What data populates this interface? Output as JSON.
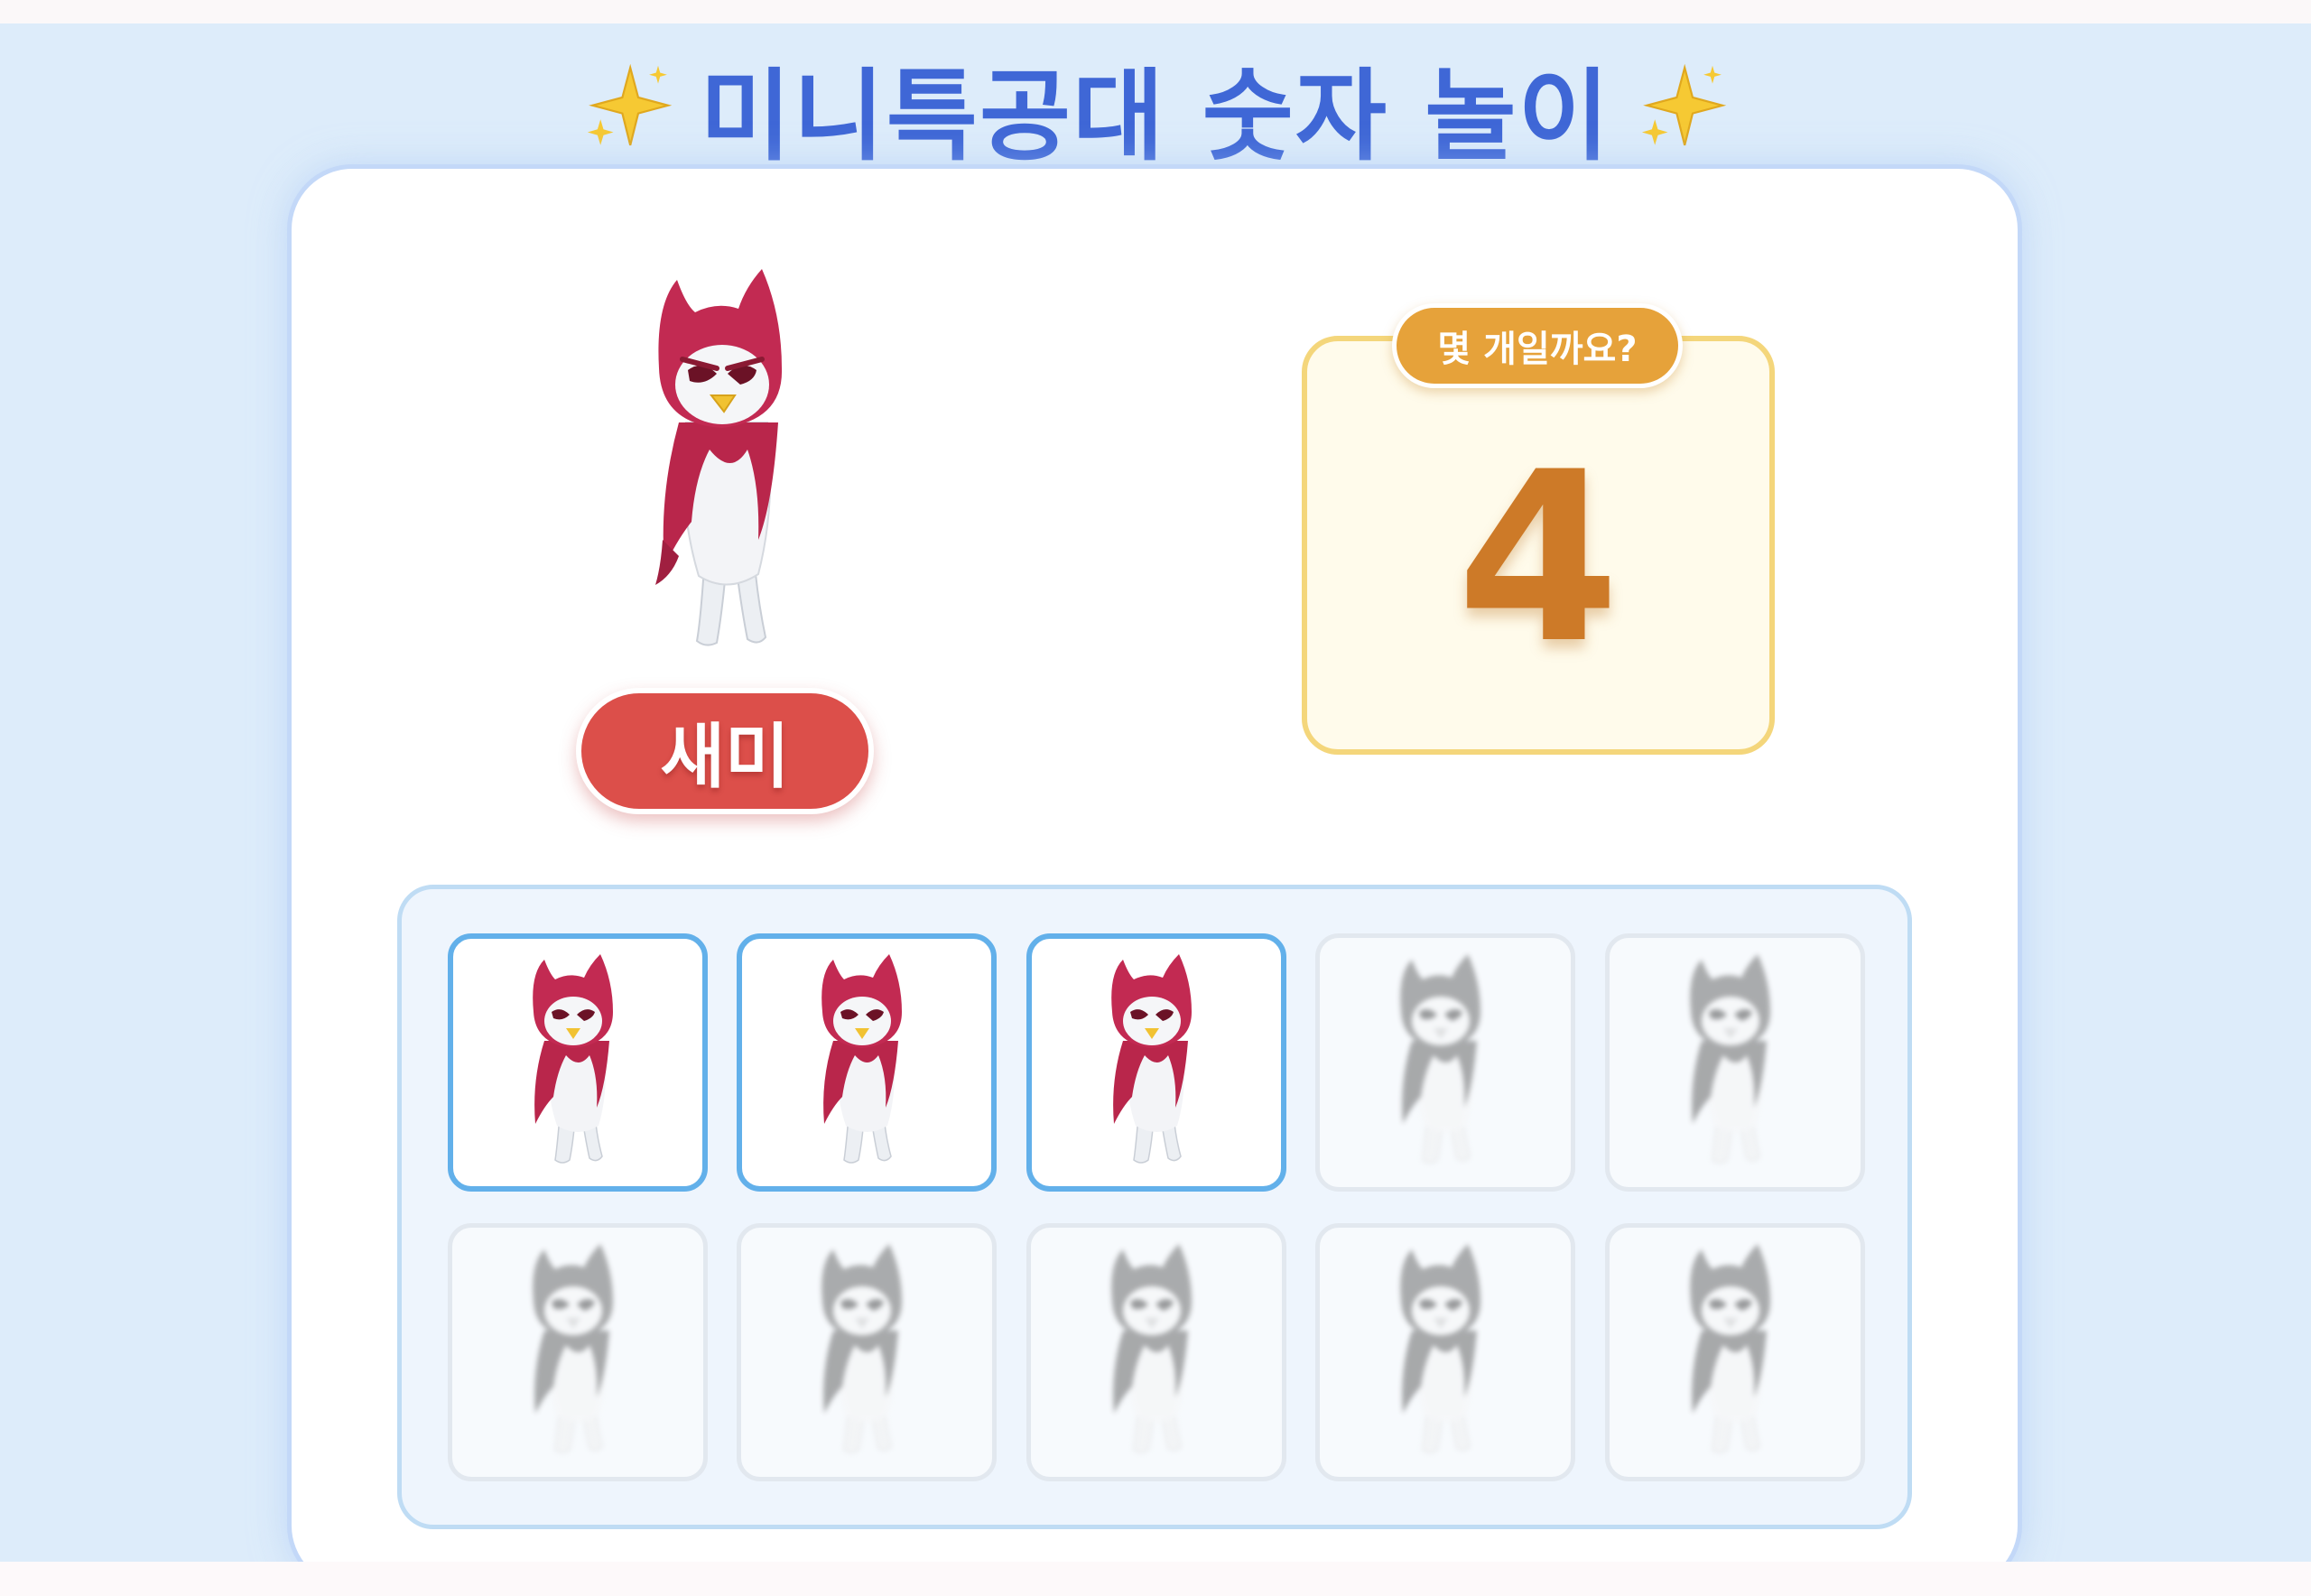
{
  "title": {
    "text": "미니특공대 숫자 놀이",
    "left_icon": "sparkles-icon",
    "right_icon": "sparkles-icon"
  },
  "character": {
    "name": "새미",
    "icon": "penguin-character"
  },
  "question": {
    "label": "몇 개일까요?",
    "answer": "4"
  },
  "counting_grid": {
    "filled_count": 3,
    "total": 10
  },
  "colors": {
    "background": "#ddecfa",
    "title": "#3f67d6",
    "name_pill": "#dc4f4a",
    "question_pill": "#e6a23a",
    "answer_number": "#cd7a28",
    "tile_border_active": "#62b0ea"
  }
}
